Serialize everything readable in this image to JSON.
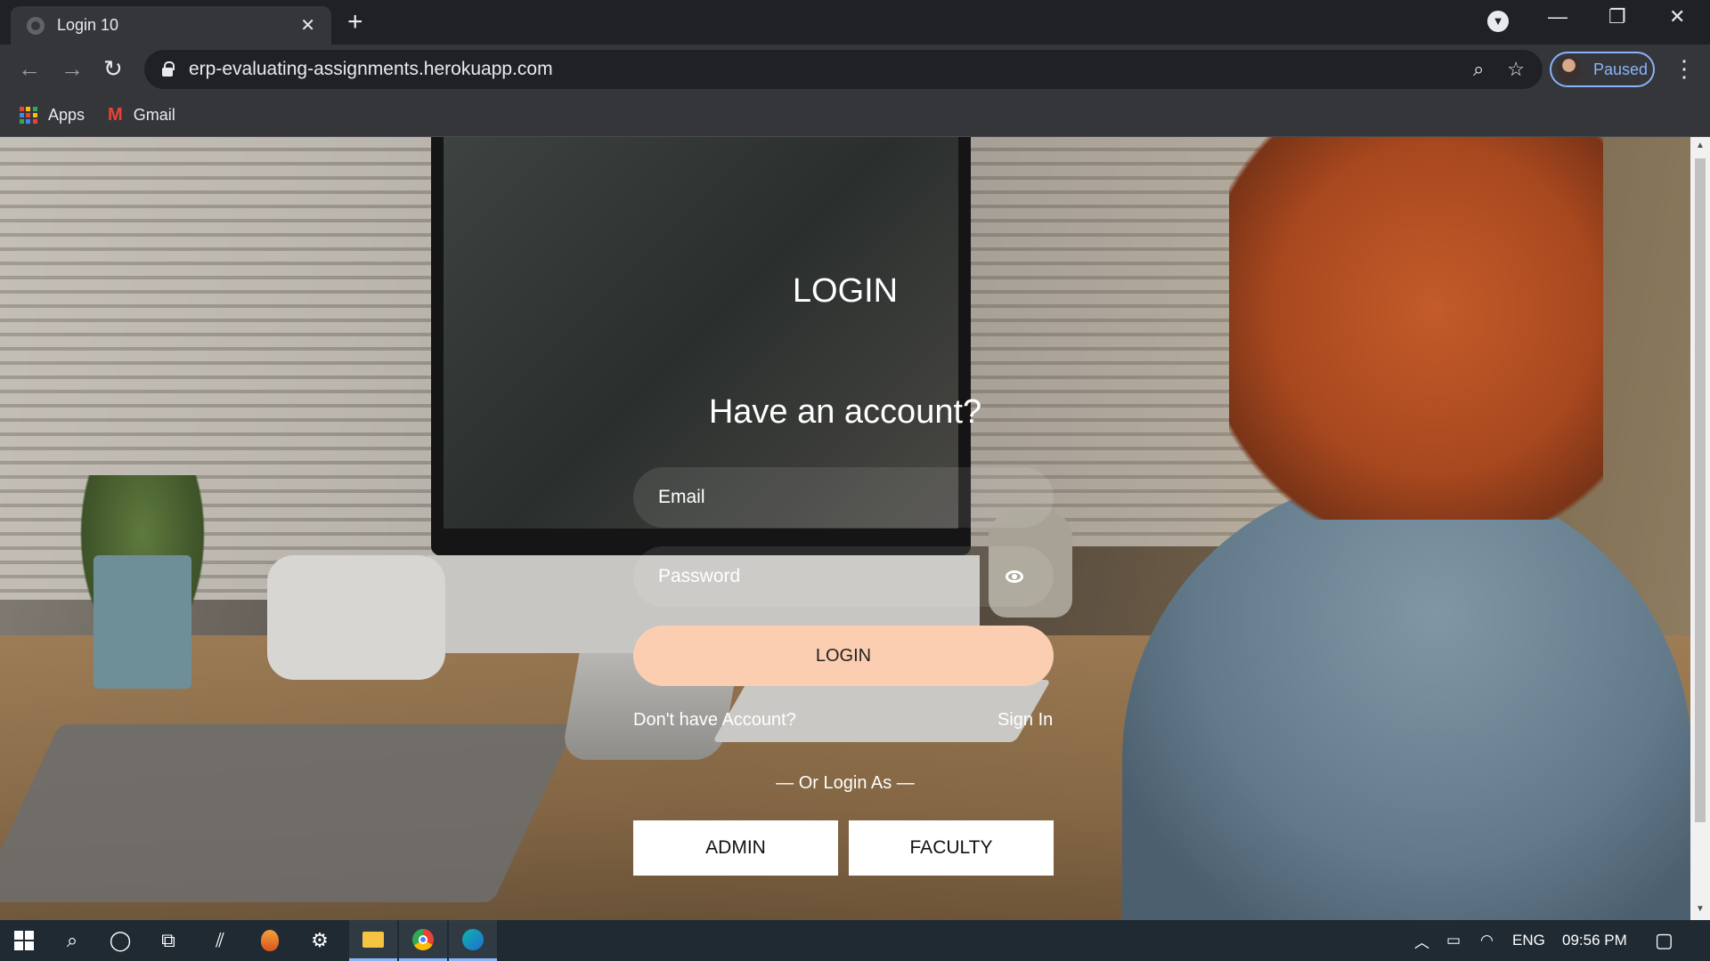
{
  "browser": {
    "tab_title": "Login 10",
    "url": "erp-evaluating-assignments.herokuapp.com",
    "profile_status": "Paused",
    "bookmarks": [
      {
        "label": "Apps",
        "icon": "apps-grid-icon"
      },
      {
        "label": "Gmail",
        "icon": "gmail-icon"
      }
    ]
  },
  "login": {
    "title": "LOGIN",
    "subtitle": "Have an account?",
    "email_placeholder": "Email",
    "password_placeholder": "Password",
    "login_button": "LOGIN",
    "no_account_text": "Don't have Account?",
    "sign_in_link": "Sign In",
    "or_login_as": "— Or Login As —",
    "roles": [
      "ADMIN",
      "FACULTY"
    ],
    "accent_color": "#fbceb1"
  },
  "taskbar": {
    "language": "ENG",
    "time": "09:56 PM"
  }
}
